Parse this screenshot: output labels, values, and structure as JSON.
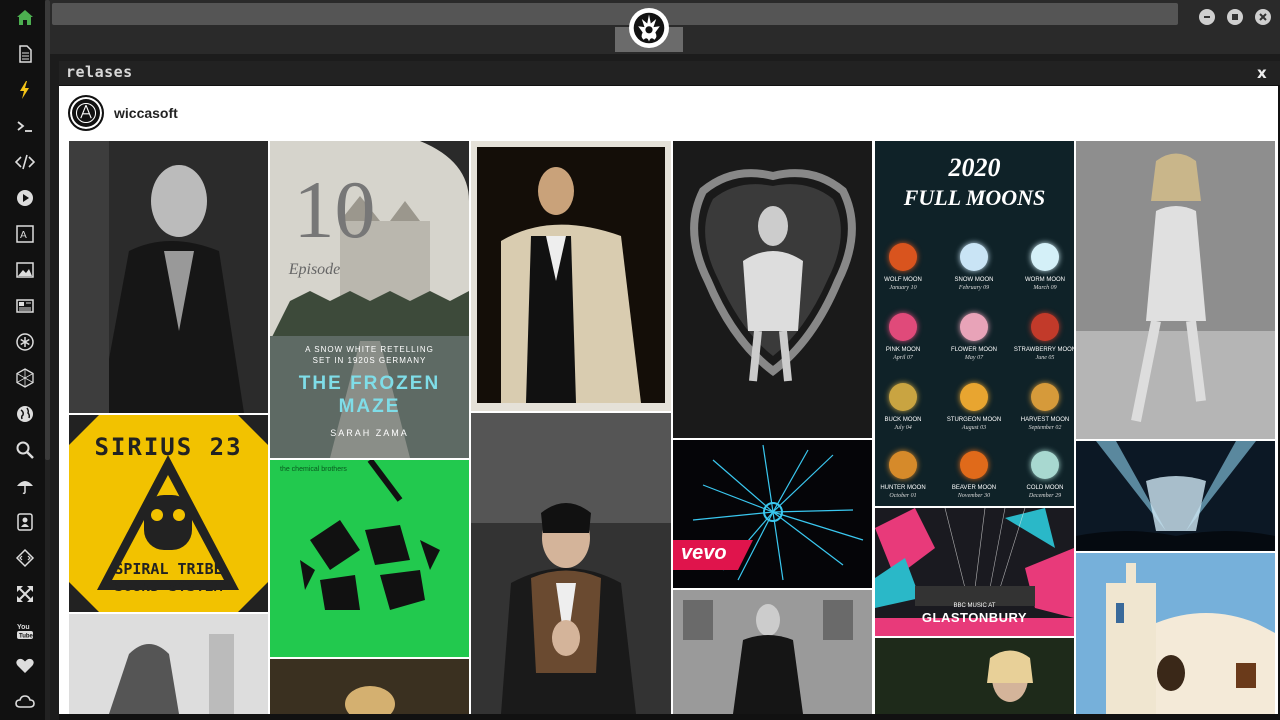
{
  "sidebar": {
    "items": [
      {
        "name": "home-icon",
        "color": "#4caf50"
      },
      {
        "name": "document-icon"
      },
      {
        "name": "lightning-icon",
        "color": "#f5c518"
      },
      {
        "name": "terminal-icon"
      },
      {
        "name": "code-icon"
      },
      {
        "name": "play-icon"
      },
      {
        "name": "translate-icon"
      },
      {
        "name": "image-icon"
      },
      {
        "name": "newspaper-icon"
      },
      {
        "name": "asterisk-icon"
      },
      {
        "name": "hexagon-icon"
      },
      {
        "name": "globe-icon"
      },
      {
        "name": "search-icon"
      },
      {
        "name": "umbrella-icon"
      },
      {
        "name": "contact-icon"
      },
      {
        "name": "diamond-code-icon"
      },
      {
        "name": "expand-icon"
      },
      {
        "name": "youtube-icon"
      },
      {
        "name": "heart-icon"
      },
      {
        "name": "cloud-icon"
      }
    ]
  },
  "window": {
    "logo": "rebel-alliance-icon",
    "controls": [
      "minimize",
      "maximize",
      "close"
    ]
  },
  "panel": {
    "title": "relases",
    "close_label": "x"
  },
  "profile": {
    "username": "wiccasoft"
  },
  "tiles": {
    "frozen_maze": {
      "number": "10",
      "episode": "Episode",
      "subtitle_1": "A SNOW WHITE RETELLING",
      "subtitle_2": "SET IN 1920S GERMANY",
      "title_1": "THE FROZEN",
      "title_2": "MAZE",
      "author": "SARAH ZAMA"
    },
    "sirius": {
      "line1": "SIRIUS 23",
      "line2": "SPIRAL TRIBE",
      "line3": "SOUND SYSTEM"
    },
    "chemical": {
      "label": "the chemical brothers"
    },
    "vevo": {
      "label": "vevo"
    },
    "moons": {
      "title_1": "2020",
      "title_2": "FULL MOONS",
      "items": [
        {
          "name": "WOLF MOON",
          "date": "January 10",
          "color": "#d9541e"
        },
        {
          "name": "SNOW MOON",
          "date": "February 09",
          "color": "#c9e4f5"
        },
        {
          "name": "WORM MOON",
          "date": "March 09",
          "color": "#d4f0f8"
        },
        {
          "name": "PINK MOON",
          "date": "April 07",
          "color": "#e04a7a"
        },
        {
          "name": "FLOWER MOON",
          "date": "May 07",
          "color": "#e8a3b8"
        },
        {
          "name": "STRAWBERRY MOON",
          "date": "June 05",
          "color": "#c23a2a"
        },
        {
          "name": "BUCK MOON",
          "date": "July 04",
          "color": "#c9a441"
        },
        {
          "name": "STURGEON MOON",
          "date": "August 03",
          "color": "#e8a530"
        },
        {
          "name": "HARVEST MOON",
          "date": "September 02",
          "color": "#d69a3a"
        },
        {
          "name": "HUNTER MOON",
          "date": "October 01",
          "color": "#d68a2a"
        },
        {
          "name": "BEAVER MOON",
          "date": "November 30",
          "color": "#e06a1a"
        },
        {
          "name": "COLD MOON",
          "date": "December 29",
          "color": "#a8d8d0"
        }
      ]
    },
    "glastonbury": {
      "prefix": "BBC MUSIC AT",
      "label": "GLASTONBURY"
    }
  }
}
